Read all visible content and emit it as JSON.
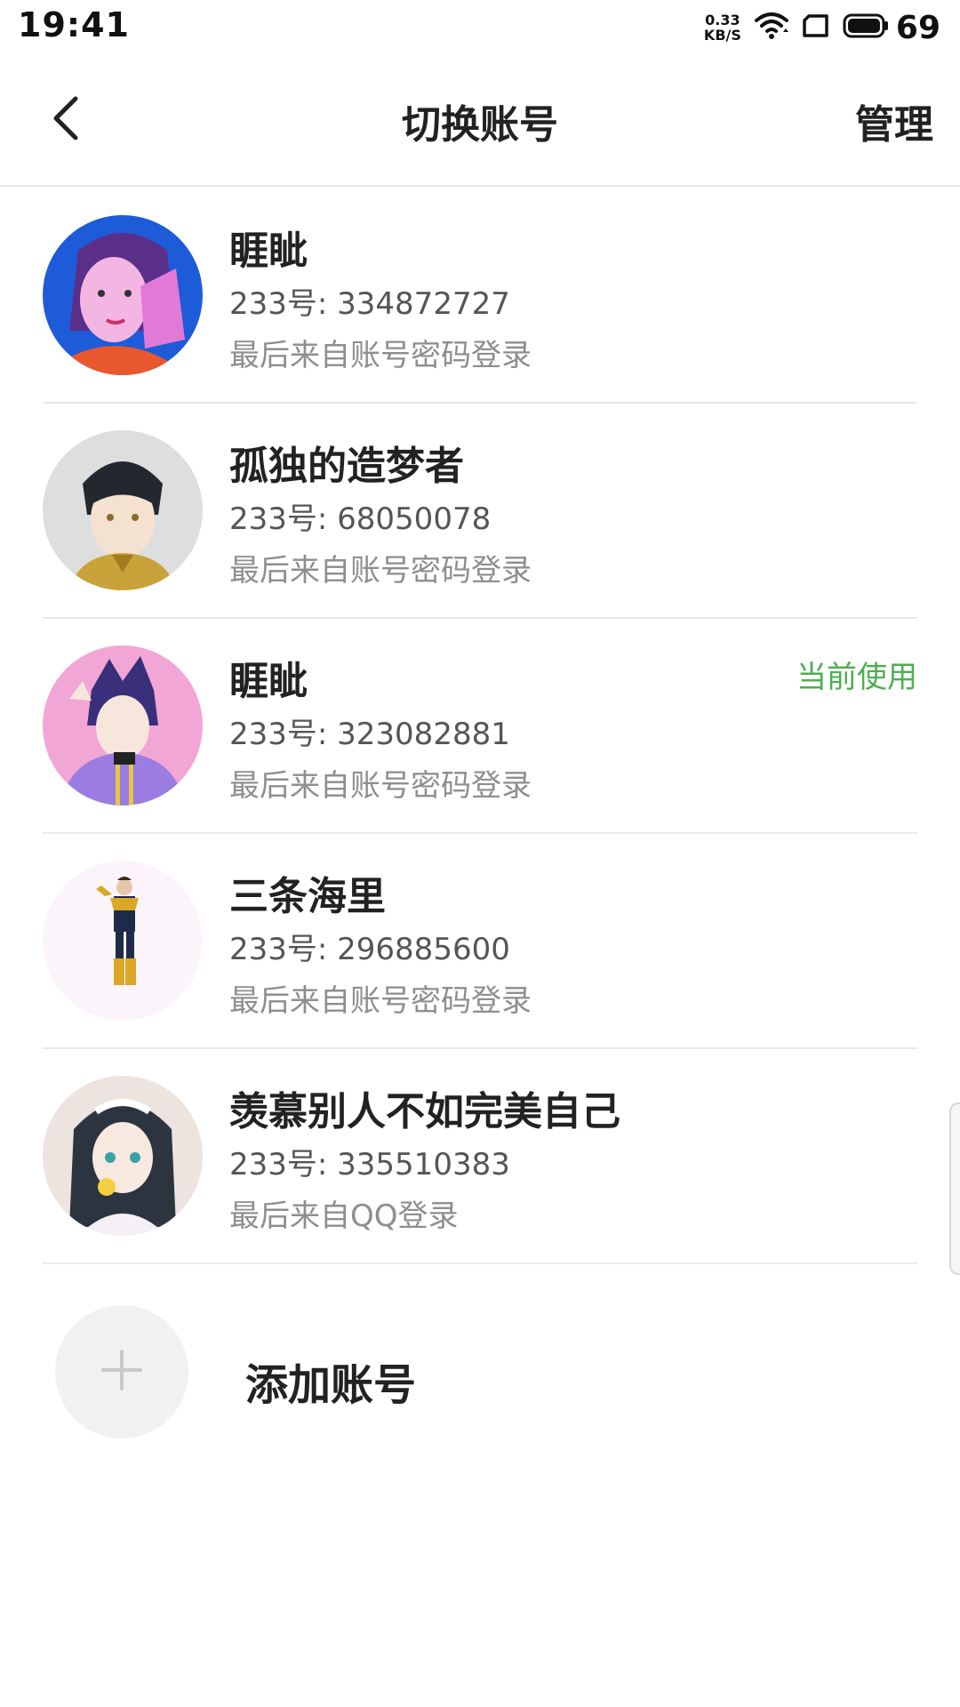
{
  "status_bar": {
    "time": "19:41",
    "speed_value": "0.33",
    "speed_unit": "KB/S",
    "battery": "69",
    "icons": [
      "wifi-icon",
      "sim-icon",
      "battery-icon"
    ]
  },
  "header": {
    "title": "切换账号",
    "manage_label": "管理",
    "back_icon": "chevron-left-icon"
  },
  "accounts": [
    {
      "name": "睚眦",
      "id_text": "233号: 334872727",
      "login_text": "最后来自账号密码登录",
      "current": "",
      "avatar_colors": [
        "#1e5bd8",
        "#e07ad6"
      ]
    },
    {
      "name": "孤独的造梦者",
      "id_text": "233号: 68050078",
      "login_text": "最后来自账号密码登录",
      "current": "",
      "avatar_colors": [
        "#dedede",
        "#c9a23a"
      ]
    },
    {
      "name": "睚眦",
      "id_text": "233号: 323082881",
      "login_text": "最后来自账号密码登录",
      "current": "当前使用",
      "avatar_colors": [
        "#f2a6d6",
        "#9b7ce0"
      ]
    },
    {
      "name": "三条海里",
      "id_text": "233号: 296885600",
      "login_text": "最后来自账号密码登录",
      "current": "",
      "avatar_colors": [
        "#fbf5fb",
        "#1f2a4a"
      ]
    },
    {
      "name": "羡慕别人不如完美自己",
      "id_text": "233号: 335510383",
      "login_text": "最后来自QQ登录",
      "current": "",
      "avatar_colors": [
        "#ede3df",
        "#2c3440"
      ]
    }
  ],
  "add_account": {
    "label": "添加账号",
    "icon": "plus-icon"
  },
  "colors": {
    "current_badge": "#4caf50",
    "divider": "#e9e9e9",
    "secondary_text": "#8e8e8e"
  }
}
